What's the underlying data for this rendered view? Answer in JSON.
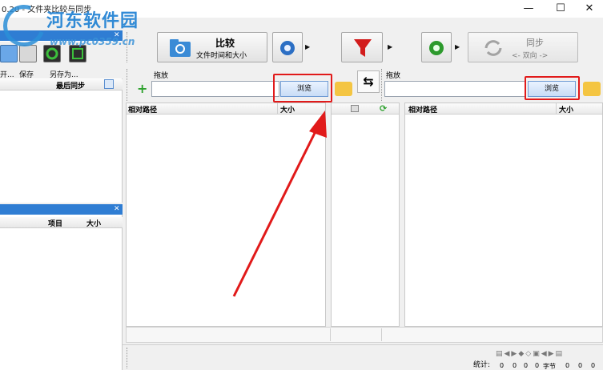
{
  "window": {
    "title": "0.20 - 文件夹比较与同步",
    "minimize_glyph": "—",
    "maximize_glyph": "☐",
    "close_glyph": "✕"
  },
  "watermark": {
    "title": "河东软件园",
    "url": "www.pc0359.cn"
  },
  "left_panel": {
    "toolbar": {
      "open_label": "开...",
      "save_label": "保存",
      "save_as_label": "另存为..."
    },
    "column_last_sync": "最后同步",
    "close_glyph": "✕",
    "bottom_columns": {
      "items": "项目",
      "size": "大小"
    }
  },
  "toolbar": {
    "compare_title": "比较",
    "compare_subtitle": "文件时间和大小",
    "sync_title": "同步",
    "sync_subtitle": "<- 双向 ->"
  },
  "left_folder": {
    "label": "拖放",
    "path_value": "",
    "browse_label": "浏览"
  },
  "right_folder": {
    "label": "拖放",
    "path_value": "",
    "browse_label": "浏览"
  },
  "left_grid": {
    "col_path": "相对路径",
    "col_size": "大小"
  },
  "right_grid": {
    "col_path": "相对路径",
    "col_size": "大小"
  },
  "stats": {
    "label": "统计:",
    "counts": [
      "0",
      "0",
      "0",
      "0",
      "0",
      "0",
      "0",
      "0",
      "0"
    ],
    "bytes_label": "字节"
  },
  "colors": {
    "accent_blue": "#2f7dd3",
    "highlight_red": "#e11a1a"
  }
}
